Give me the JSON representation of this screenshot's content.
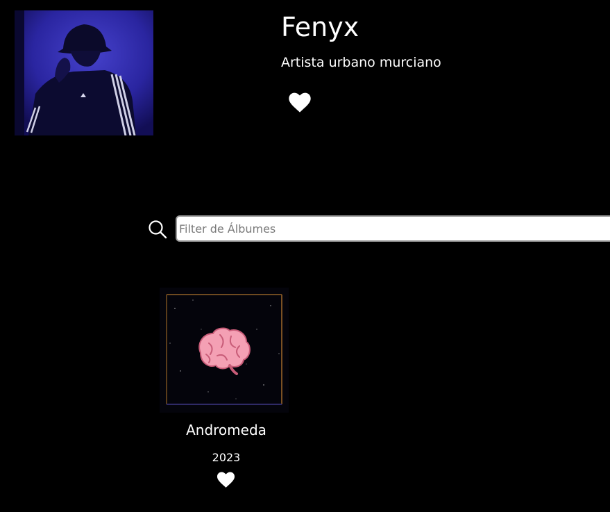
{
  "artist": {
    "name": "Fenyx",
    "description": "Artista urbano murciano"
  },
  "search": {
    "placeholder": "Filter de Álbumes",
    "value": ""
  },
  "albums": [
    {
      "title": "Andromeda",
      "year": "2023"
    }
  ],
  "colors": {
    "background": "#000000",
    "text": "#ffffff",
    "photo_tint": "#2c27a3",
    "heart": "#ffffff",
    "brain": "#f4a0b4"
  },
  "icons": {
    "favorite": "heart-icon",
    "search": "search-icon"
  }
}
